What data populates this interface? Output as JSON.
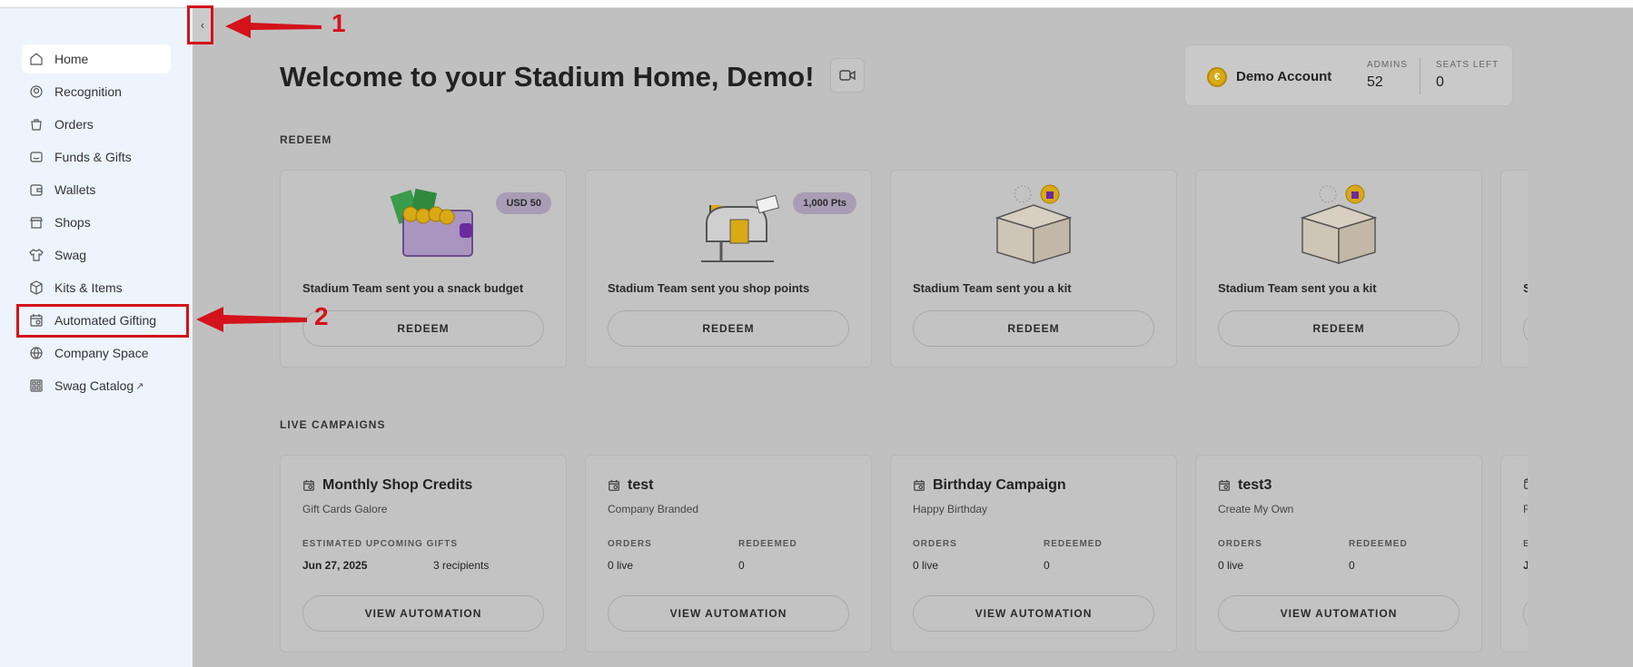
{
  "sidebar": {
    "items": [
      {
        "label": "Home",
        "icon": "home-icon",
        "active": true
      },
      {
        "label": "Recognition",
        "icon": "recognition-icon"
      },
      {
        "label": "Orders",
        "icon": "orders-icon"
      },
      {
        "label": "Funds & Gifts",
        "icon": "funds-icon"
      },
      {
        "label": "Wallets",
        "icon": "wallet-icon"
      },
      {
        "label": "Shops",
        "icon": "shop-icon"
      },
      {
        "label": "Swag",
        "icon": "shirt-icon"
      },
      {
        "label": "Kits & Items",
        "icon": "box-icon"
      },
      {
        "label": "Automated Gifting",
        "icon": "calendar-icon"
      },
      {
        "label": "Company Space",
        "icon": "globe-icon"
      },
      {
        "label": "Swag Catalog",
        "icon": "catalog-icon",
        "external": "↗"
      }
    ],
    "collapse_glyph": "‹"
  },
  "header": {
    "title": "Welcome to your Stadium Home, Demo!"
  },
  "account": {
    "coin_glyph": "€",
    "name": "Demo Account",
    "admins_label": "ADMINS",
    "admins_value": "52",
    "seats_label": "SEATS LEFT",
    "seats_value": "0"
  },
  "redeem": {
    "section_label": "REDEEM",
    "cards": [
      {
        "badge": "USD 50",
        "text": "Stadium Team sent you a snack budget",
        "button": "REDEEM",
        "illustration": "wallet-money"
      },
      {
        "badge": "1,000 Pts",
        "text": "Stadium Team sent you shop points",
        "button": "REDEEM",
        "illustration": "mailbox"
      },
      {
        "badge": "",
        "text": "Stadium Team sent you a kit",
        "button": "REDEEM",
        "illustration": "kit-box"
      },
      {
        "badge": "",
        "text": "Stadium Team sent you a kit",
        "button": "REDEEM",
        "illustration": "kit-box"
      },
      {
        "badge": "",
        "text": "S",
        "button": "",
        "illustration": ""
      }
    ]
  },
  "campaigns": {
    "section_label": "LIVE CAMPAIGNS",
    "cards": [
      {
        "title": "Monthly Shop Credits",
        "subtitle": "Gift Cards Galore",
        "col1_label": "ESTIMATED UPCOMING GIFTS",
        "col1_value": "Jun 27, 2025",
        "col2_label": "",
        "col2_value": "3 recipients",
        "button": "VIEW AUTOMATION"
      },
      {
        "title": "test",
        "subtitle": "Company Branded",
        "col1_label": "ORDERS",
        "col1_value": "0 live",
        "col2_label": "REDEEMED",
        "col2_value": "0",
        "button": "VIEW AUTOMATION"
      },
      {
        "title": "Birthday Campaign",
        "subtitle": "Happy Birthday",
        "col1_label": "ORDERS",
        "col1_value": "0 live",
        "col2_label": "REDEEMED",
        "col2_value": "0",
        "button": "VIEW AUTOMATION"
      },
      {
        "title": "test3",
        "subtitle": "Create My Own",
        "col1_label": "ORDERS",
        "col1_value": "0 live",
        "col2_label": "REDEEMED",
        "col2_value": "0",
        "button": "VIEW AUTOMATION"
      },
      {
        "title": "",
        "subtitle": "R",
        "col1_label": "E",
        "col1_value": "J",
        "col2_label": "",
        "col2_value": "",
        "button": ""
      }
    ]
  },
  "annotations": {
    "marker_1": "1",
    "marker_2": "2",
    "color": "#d3121b"
  }
}
